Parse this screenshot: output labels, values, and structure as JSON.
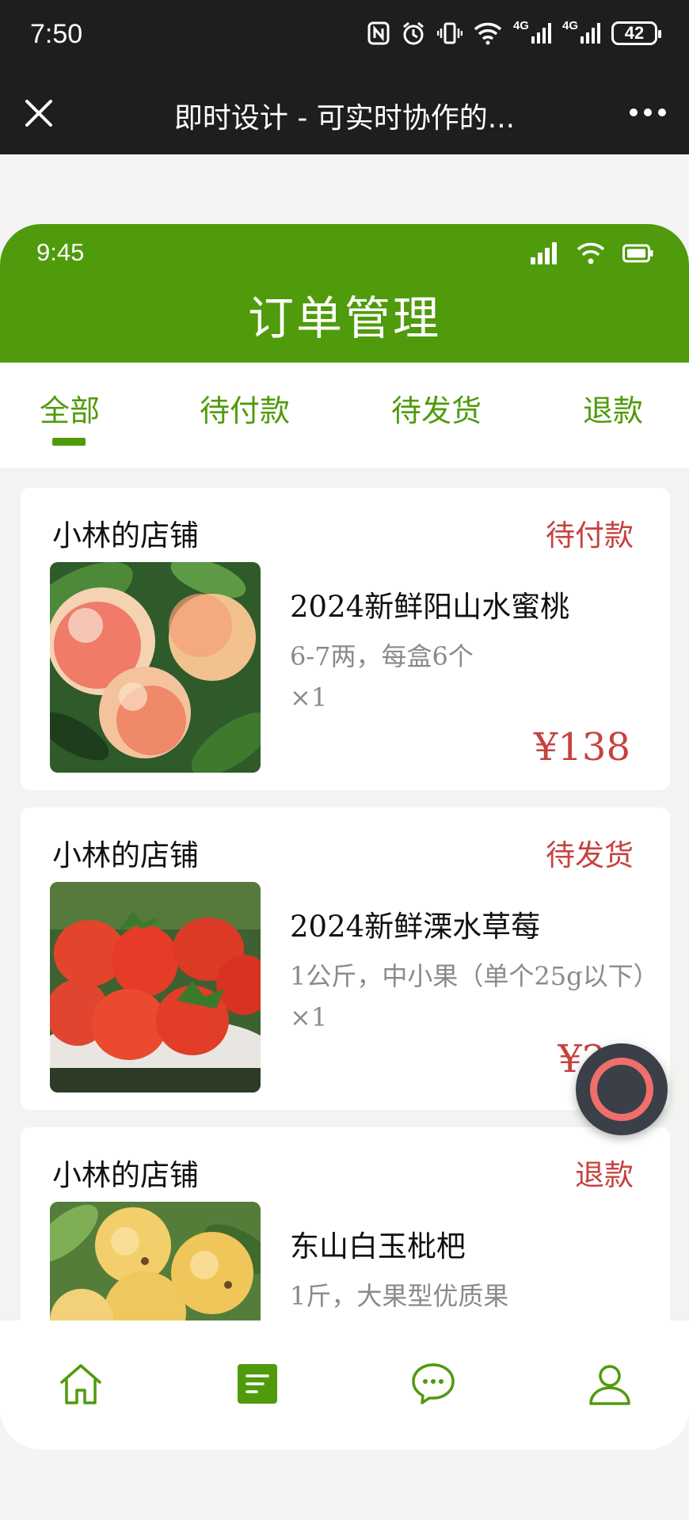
{
  "system_status": {
    "time": "7:50",
    "network_1": "4G",
    "network_2": "4G",
    "battery": "42"
  },
  "browser": {
    "title": "即时设计 - 可实时协作的..."
  },
  "phone": {
    "time": "9:45",
    "title": "订单管理"
  },
  "tabs": [
    {
      "label": "全部"
    },
    {
      "label": "待付款"
    },
    {
      "label": "待发货"
    },
    {
      "label": "退款"
    }
  ],
  "orders": [
    {
      "shop": "小林的店铺",
      "status": "待付款",
      "product": "2024新鲜阳山水蜜桃",
      "spec": "6-7两，每盒6个",
      "qty": "×1",
      "price": "¥138"
    },
    {
      "shop": "小林的店铺",
      "status": "待发货",
      "product": "2024新鲜溧水草莓",
      "spec": "1公斤，中小果（单个25g以下）",
      "qty": "×1",
      "price": "¥20"
    },
    {
      "shop": "小林的店铺",
      "status": "退款",
      "product": "东山白玉枇杷",
      "spec": "1斤，大果型优质果"
    }
  ],
  "colors": {
    "brand_green": "#4f9b0c",
    "status_red": "#c6423f"
  },
  "icons": {
    "nav_home": "home-icon",
    "nav_orders": "orders-icon",
    "nav_messages": "chat-icon",
    "nav_profile": "user-icon"
  }
}
